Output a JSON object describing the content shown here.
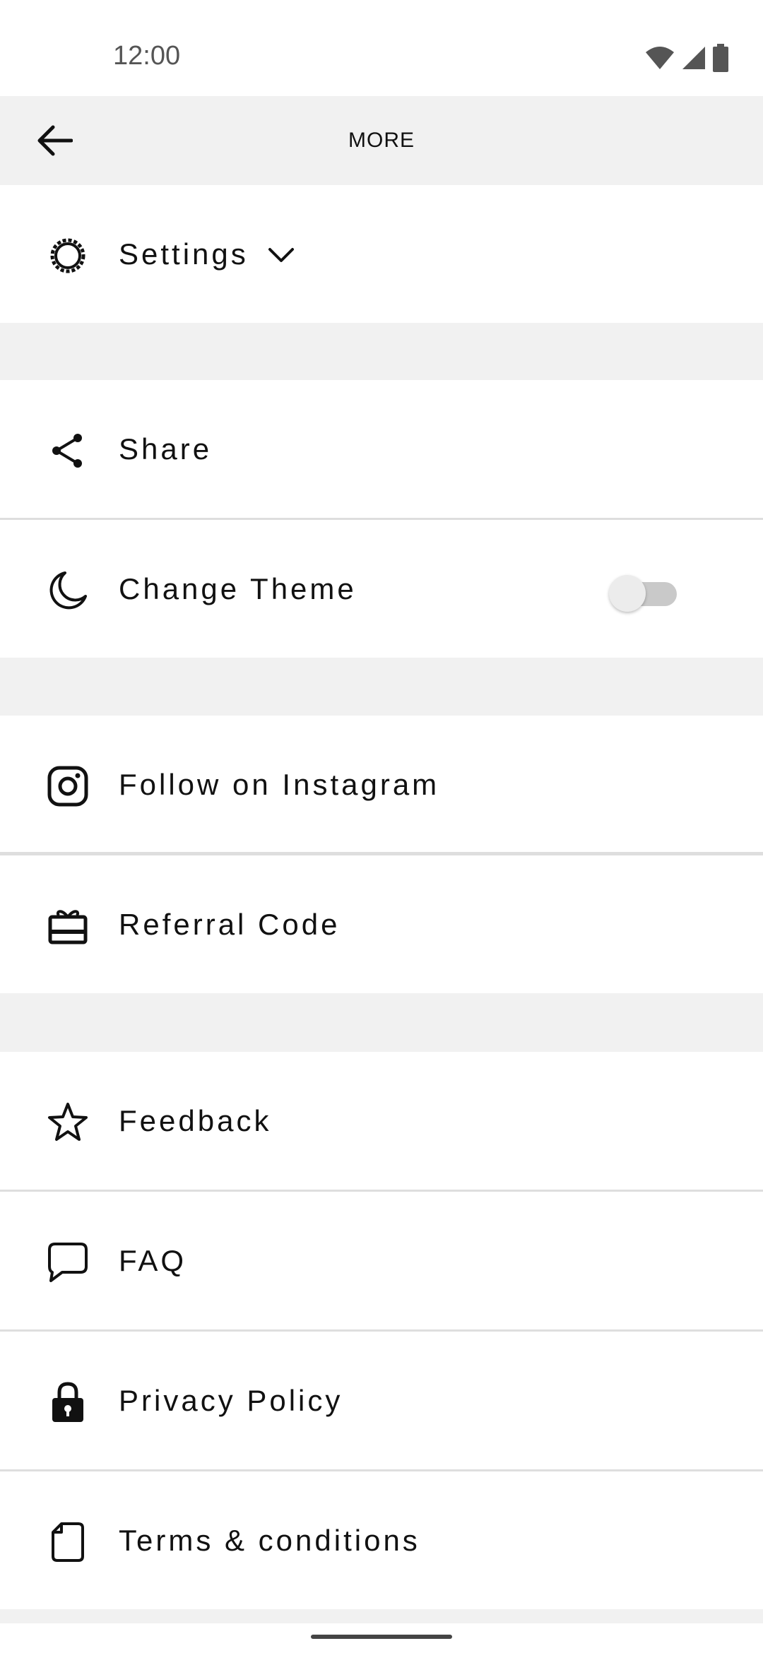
{
  "status_bar": {
    "time": "12:00"
  },
  "app_bar": {
    "title": "MORE"
  },
  "menu": {
    "settings": "Settings",
    "share": "Share",
    "change_theme": "Change Theme",
    "theme_toggle_on": false,
    "instagram": "Follow on Instagram",
    "referral": "Referral Code",
    "feedback": "Feedback",
    "faq": "FAQ",
    "privacy": "Privacy Policy",
    "terms": "Terms & conditions"
  }
}
